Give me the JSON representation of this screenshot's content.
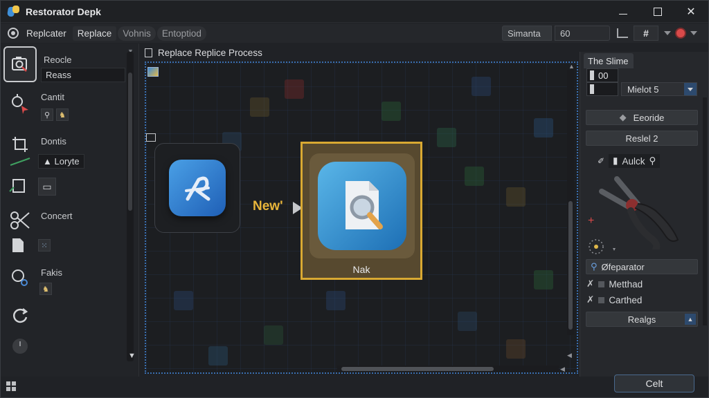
{
  "app": {
    "title": "Restorator Depk"
  },
  "window_controls": {
    "minimize": "minimize",
    "maximize": "maximize",
    "close": "✕"
  },
  "menubar": {
    "items": [
      {
        "label": "Replcater"
      },
      {
        "label": "Replace"
      },
      {
        "label": "Vohnis"
      },
      {
        "label": "Entoptiod"
      }
    ],
    "field_label": "Simanta",
    "field_value": "60",
    "hash_label": "#"
  },
  "left_panel": {
    "tools": [
      {
        "label": "Reocle",
        "sub_label": "Reass"
      },
      {
        "label": "Cantit"
      },
      {
        "label": "Dontis",
        "sub_label": "Loryte"
      },
      {
        "label": "Concert"
      },
      {
        "label": "Fakis"
      }
    ]
  },
  "canvas": {
    "title": "Replace Replice Process",
    "arrow_label": "New'",
    "target_label": "Nak"
  },
  "right_panel": {
    "tab_label": "The Slime",
    "input_value": "00",
    "select_value": "Mielot 5",
    "buttons": [
      {
        "label": "Eeoride"
      },
      {
        "label": "Reslel 2"
      }
    ],
    "tool_label": "Aulck",
    "rows": [
      {
        "label": "Øfeparator"
      },
      {
        "label": "Metthad"
      },
      {
        "label": "Carthed"
      }
    ],
    "reload_label": "Realgs",
    "ok_label": "Celt"
  },
  "colors": {
    "accent_gold": "#d9a932",
    "accent_blue": "#3a6fb0",
    "record_red": "#d94a4a"
  }
}
